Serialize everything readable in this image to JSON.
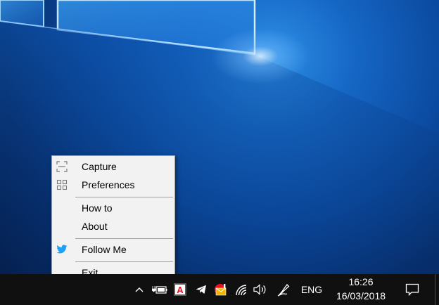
{
  "menu": {
    "items": [
      {
        "label": "Capture",
        "icon": "capture-icon"
      },
      {
        "label": "Preferences",
        "icon": "preferences-icon"
      },
      {
        "label": "How to",
        "icon": ""
      },
      {
        "label": "About",
        "icon": ""
      },
      {
        "label": "Follow Me",
        "icon": "twitter-icon"
      },
      {
        "label": "Exit",
        "icon": ""
      }
    ]
  },
  "taskbar": {
    "language": "ENG",
    "time": "16:26",
    "date": "16/03/2018",
    "tray_icons": [
      "show-hidden-icons-chevron-icon",
      "battery-plug-icon",
      "app-letter-a-icon",
      "telegram-icon",
      "mail-alert-icon",
      "wifi-icon",
      "volume-icon",
      "pen-icon",
      "notification-center-icon"
    ]
  },
  "colors": {
    "taskbar_bg": "#101010",
    "menu_bg": "#f2f2f2",
    "twitter_blue": "#1da1f2",
    "app_a_red": "#e81123"
  }
}
